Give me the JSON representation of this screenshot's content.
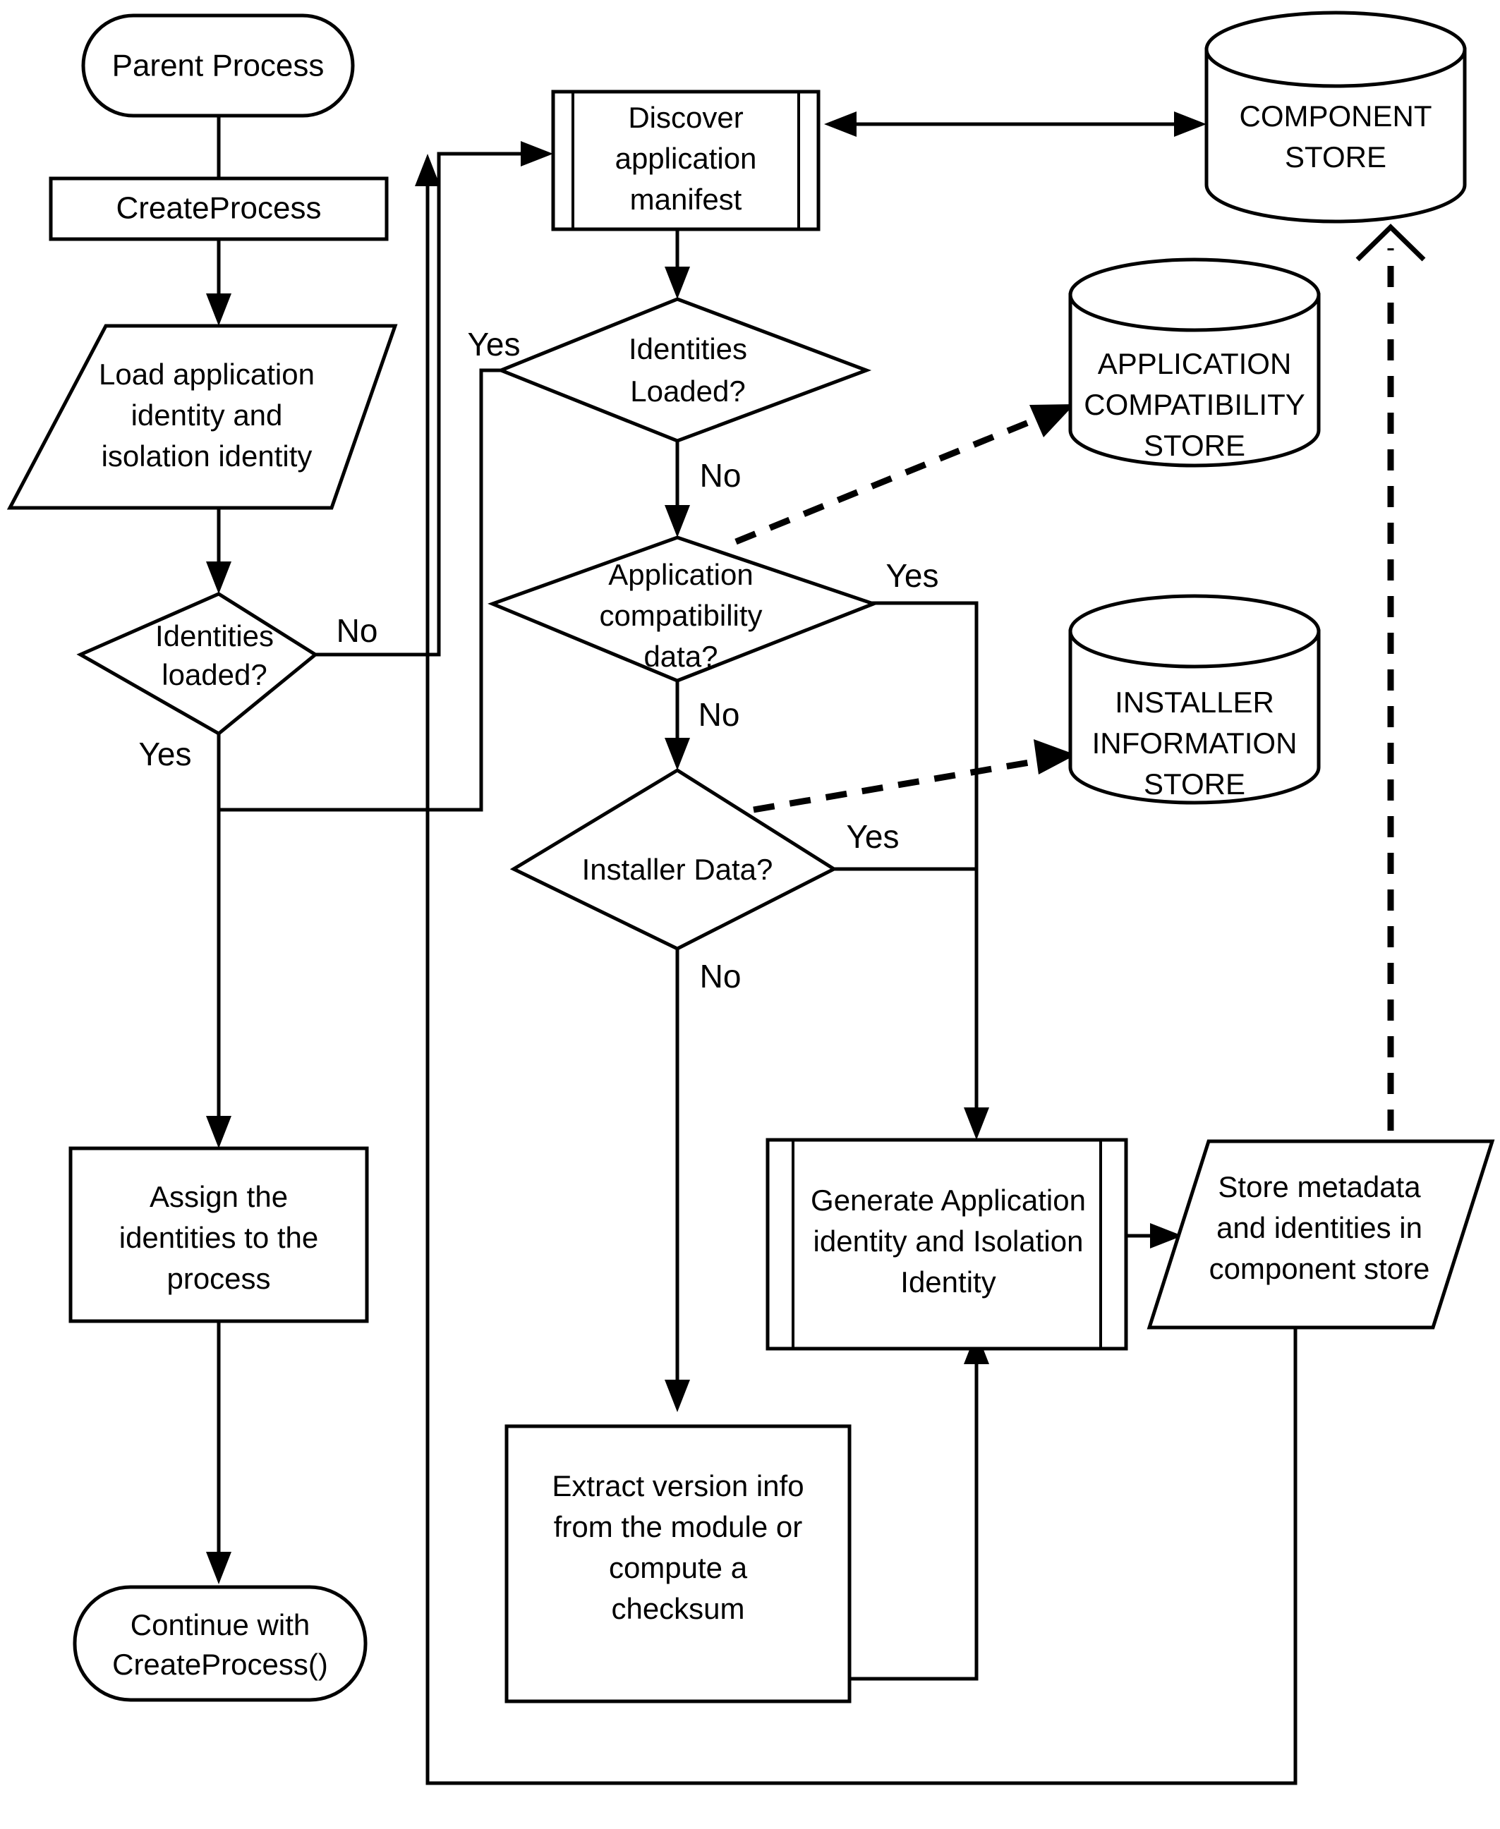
{
  "diagram": {
    "title": "Process creation identity resolution flowchart",
    "type": "flowchart",
    "background_color": "#ffffff",
    "line_color": "#000000"
  },
  "nodes": {
    "parent_process": {
      "label": "Parent Process",
      "shape": "terminator"
    },
    "create_process": {
      "label": "CreateProcess",
      "shape": "process"
    },
    "load_identity": {
      "label_line1": "Load application",
      "label_line2": "identity and",
      "label_line3": "isolation identity",
      "shape": "parallelogram"
    },
    "identities_loaded_left": {
      "label_line1": "Identities",
      "label_line2": "loaded?",
      "shape": "decision"
    },
    "assign_identities": {
      "label_line1": "Assign the",
      "label_line2": "identities to the",
      "label_line3": "process",
      "shape": "process"
    },
    "continue_createprocess": {
      "label_line1": "Continue with",
      "label_line2": "CreateProcess()",
      "shape": "terminator"
    },
    "discover_manifest": {
      "label_line1": "Discover",
      "label_line2": "application",
      "label_line3": "manifest",
      "shape": "predefined-process"
    },
    "identities_loaded_mid": {
      "label_line1": "Identities",
      "label_line2": "Loaded?",
      "shape": "decision"
    },
    "app_compat_data": {
      "label_line1": "Application",
      "label_line2": "compatibility",
      "label_line3": "data?",
      "shape": "decision"
    },
    "installer_data": {
      "label": "Installer Data?",
      "shape": "decision"
    },
    "extract_version": {
      "label_line1": "Extract version info",
      "label_line2": "from the module or",
      "label_line3": "compute a",
      "label_line4": "checksum",
      "shape": "process"
    },
    "generate_identity": {
      "label_line1": "Generate Application",
      "label_line2": "identity and Isolation",
      "label_line3": "Identity",
      "shape": "predefined-process"
    },
    "store_metadata": {
      "label_line1": "Store metadata",
      "label_line2": "and identities in",
      "label_line3": "component store",
      "shape": "parallelogram"
    },
    "component_store": {
      "label_line1": "COMPONENT",
      "label_line2": "STORE",
      "shape": "cylinder"
    },
    "app_compat_store": {
      "label_line1": "APPLICATION",
      "label_line2": "COMPATIBILITY",
      "label_line3": "STORE",
      "shape": "cylinder"
    },
    "installer_info_store": {
      "label_line1": "INSTALLER",
      "label_line2": "INFORMATION",
      "label_line3": "STORE",
      "shape": "cylinder"
    }
  },
  "edge_labels": {
    "left_no": "No",
    "left_yes": "Yes",
    "mid_yes": "Yes",
    "mid_no": "No",
    "compat_yes": "Yes",
    "compat_no": "No",
    "installer_yes": "Yes",
    "installer_no": "No"
  }
}
